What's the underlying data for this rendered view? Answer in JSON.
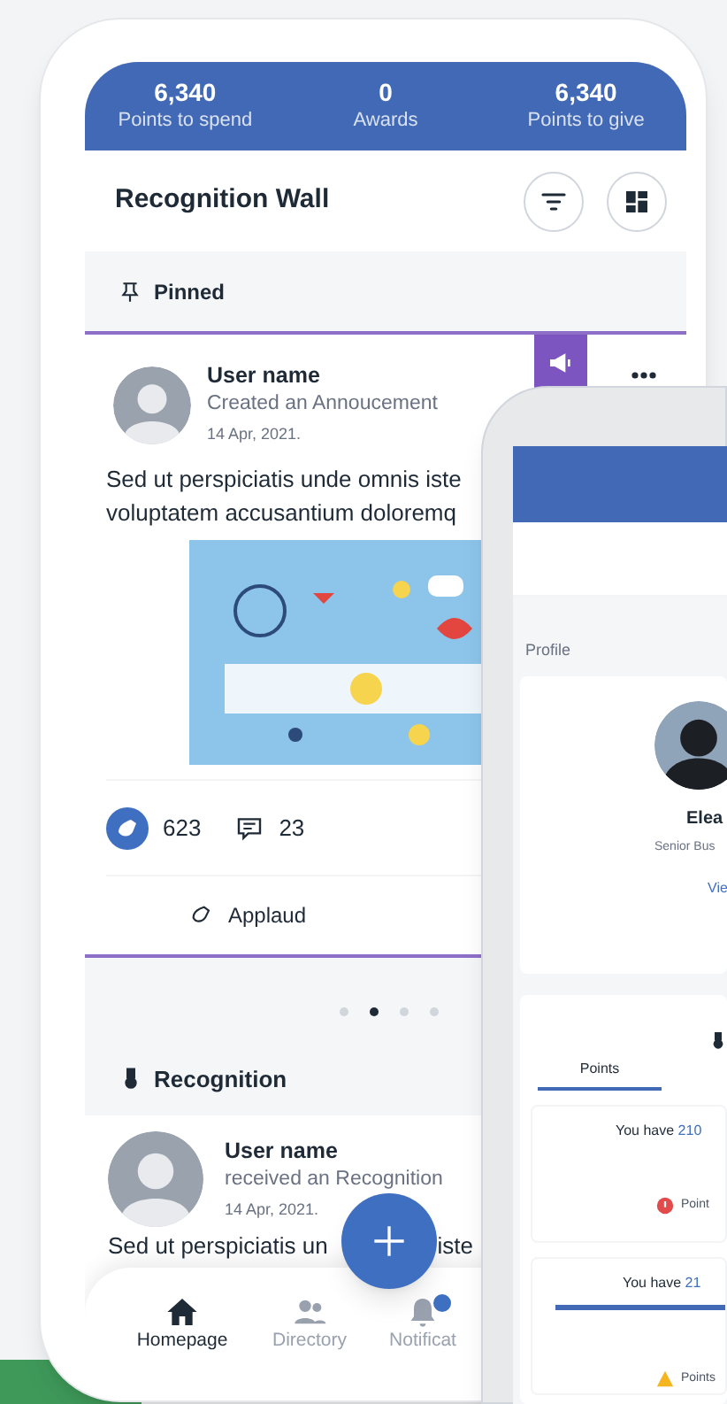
{
  "stats": [
    {
      "value": "6,340",
      "label": "Points to spend"
    },
    {
      "value": "0",
      "label": "Awards"
    },
    {
      "value": "6,340",
      "label": "Points to give"
    }
  ],
  "wall": {
    "title": "Recognition Wall"
  },
  "pinned": {
    "heading": "Pinned",
    "post": {
      "user": "User name",
      "action": "Created an Annoucement",
      "date": "14 Apr, 2021.",
      "body": [
        "Sed ut perspiciatis unde omnis iste",
        "voluptatem accusantium doloremq"
      ],
      "image": {
        "kind": "picture"
      },
      "applauds": "623",
      "comments": "23",
      "applaud_button": "Applaud"
    }
  },
  "pager": [
    {
      "selected": false
    },
    {
      "selected": true
    },
    {
      "selected": false
    },
    {
      "selected": false
    }
  ],
  "recognition": {
    "heading": "Recognition",
    "post": {
      "user": "User name",
      "action": "received an Recognition",
      "date": "14 Apr, 2021.",
      "body": [
        "Sed ut perspiciatis un",
        "iste"
      ]
    }
  },
  "nav": [
    {
      "label": "Homepage",
      "selected": true
    },
    {
      "label": "Directory",
      "selected": false
    },
    {
      "label": "Notificat",
      "selected": false,
      "badge": true
    }
  ],
  "second_screen": {
    "section": "Profile",
    "name": "Elea",
    "role": "Senior Bus",
    "link": "Vie",
    "tabs": [
      {
        "label": "Points",
        "selected": true
      }
    ],
    "cards": [
      {
        "prefix": "You have ",
        "amount": "210",
        "status": "Point",
        "kind": "error"
      },
      {
        "prefix": "You have ",
        "amount": "21",
        "status": "Points",
        "kind": "warning"
      }
    ]
  }
}
